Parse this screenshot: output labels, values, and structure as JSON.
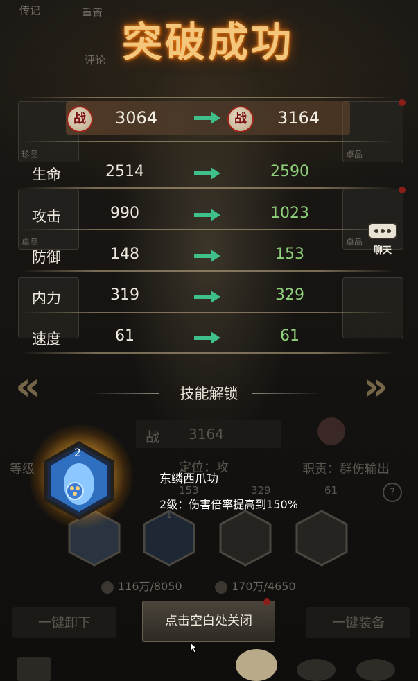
{
  "title": "突破成功",
  "top_buttons": {
    "biography": "传记",
    "reset": "重置",
    "comment": "评论"
  },
  "power": {
    "icon_text": "战",
    "before": "3064",
    "after": "3164"
  },
  "stats": [
    {
      "label": "生命",
      "before": "2514",
      "after": "2590"
    },
    {
      "label": "攻击",
      "before": "990",
      "after": "1023"
    },
    {
      "label": "防御",
      "before": "148",
      "after": "153"
    },
    {
      "label": "内力",
      "before": "319",
      "after": "329"
    },
    {
      "label": "速度",
      "before": "61",
      "after": "61"
    }
  ],
  "side_slots": {
    "left_top": "珍品",
    "left_mid": "卓品",
    "right_top": "卓品",
    "right_mid": "卓品"
  },
  "skill_unlock": {
    "header": "技能解锁",
    "level": "2",
    "name": "东鳞西爪功",
    "description": "2级：伤害倍率提高到150%"
  },
  "background_panel": {
    "power_icon": "战",
    "power": "3164",
    "level_label": "等级",
    "position": "定位：攻",
    "role": "职责：群伤输出",
    "stat_a": "153",
    "stat_b": "329",
    "stat_c": "61",
    "small_hex_level": "1",
    "resource_1": "116万/8050",
    "resource_2": "170万/4650",
    "unequip_all": "一键卸下",
    "equip_all": "一键装备"
  },
  "close_hint": "点击空白处关闭",
  "chat_label": "聊天",
  "colors": {
    "increase": "#8fd27b",
    "title_glow": "#ff8a1a",
    "arrow": "#3fbf8a"
  },
  "icons": [
    "power-badge-icon",
    "right-arrow-icon",
    "chat-icon",
    "chevron-left-icon",
    "chevron-right-icon",
    "skill-hex-icon"
  ]
}
